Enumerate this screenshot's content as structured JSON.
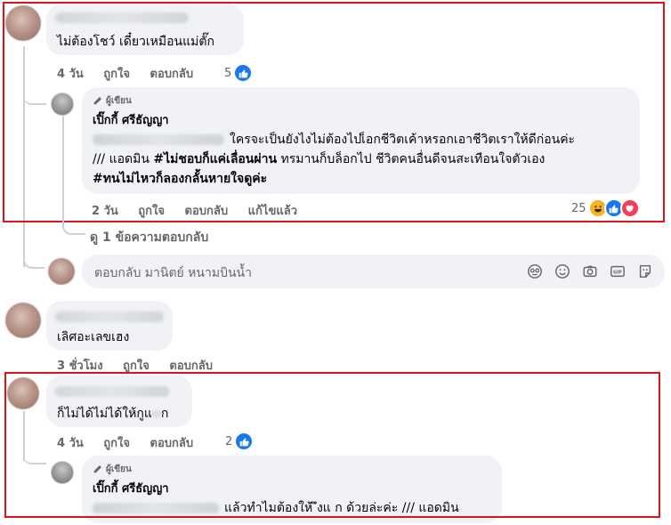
{
  "comment1": {
    "text": "ไม่ต้องโชว์ เดี๋ยวเหมือนแม่ตั๊ก",
    "time": "4 วัน",
    "like": "ถูกใจ",
    "reply": "ตอบกลับ",
    "reaction_count": "5",
    "reaction_icons": [
      "like-icon"
    ]
  },
  "reply1": {
    "badge": "ผู้เขียน",
    "author": "เปิ๊กกี้ ศรีธัญญา",
    "line1": "ใครจะเป็นยังไงไม่ต้องไปเ็อกชีวิตเค้าหรอกเอาชีวิตเราให้ดีก่อนค่ะ",
    "line2_a": "/// แอดมิน ",
    "line2_b": "#ไม่ชอบก็แค่เลื่อนผ่าน",
    "line2_c": " ทรมานก็บล็อกไป ชีวิตคนอื่นดีจนสะเทือนใจตัวเอง",
    "line3": "#ทนไม่ไหวก็ลองกลั้นหายใจดูค่ะ",
    "time": "2 วัน",
    "like": "ถูกใจ",
    "reply": "ตอบกลับ",
    "edited": "แก้ไขแล้ว",
    "reaction_count": "25",
    "reaction_icons": [
      "haha-icon",
      "like-icon",
      "love-icon"
    ]
  },
  "view_replies": "ดู 1 ข้อความตอบกลับ",
  "reply_input": {
    "placeholder": "ตอบกลับ มานิตย์ หนามบินน้ำ",
    "tools": [
      "sticker-face-icon",
      "emoji-icon",
      "camera-icon",
      "gif-icon",
      "sticker-icon"
    ]
  },
  "comment2": {
    "text": "เลิศอะเลขเฮง",
    "time": "3 ชั่วโมง",
    "like": "ถูกใจ",
    "reply": "ตอบกลับ"
  },
  "comment3": {
    "text": "ก็ไม่ได้ไม่ได้ให้กูแ",
    "text_tail": "ก",
    "time": "4 วัน",
    "like": "ถูกใจ",
    "reply": "ตอบกลับ",
    "reaction_count": "2",
    "reaction_icons": [
      "like-icon"
    ]
  },
  "reply2": {
    "badge": "ผู้เขียน",
    "author": "เปิ๊กกี้ ศรีธัญญา",
    "line1": "แล้วทำไมต้องให้ ึงแ ก ด้วยล่ะค่ะ /// แอดมิน"
  },
  "colors": {
    "bubble": "#f0f2f5",
    "meta": "#65676b",
    "highlight_box": "#e0131a",
    "like": "#1877f2"
  }
}
